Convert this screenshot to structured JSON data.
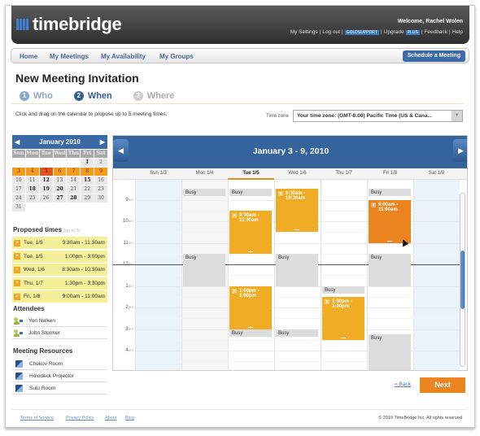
{
  "header": {
    "logo": "timebridge",
    "welcome": "Welcome, Rachel Wolen",
    "links": [
      "My Settings",
      "Log out",
      "GOLDSUPPORT",
      "Upgrade",
      "PLUS",
      "Feedback",
      "Help"
    ]
  },
  "nav": {
    "items": [
      "Home",
      "My Meetings",
      "My Availability",
      "My Groups"
    ],
    "schedule_button": "Schedule a Meeting"
  },
  "page": {
    "title": "New Meeting Invitation",
    "steps": [
      {
        "num": "1",
        "label": "Who",
        "state": "done"
      },
      {
        "num": "2",
        "label": "When",
        "state": "current"
      },
      {
        "num": "3",
        "label": "Where",
        "state": "upcoming"
      }
    ],
    "instruction": "Click and drag on the calendar to propose up to 5 meeting times.",
    "timezone_label": "Time zone",
    "timezone_value": "Your time zone: (GMT-8:00) Pacific Time (US & Cana..."
  },
  "mini_calendar": {
    "title": "January 2010",
    "prev": "◀",
    "next": "▶",
    "dow": [
      "Sun",
      "Mon",
      "Tue",
      "Wed",
      "Thu",
      "Fri",
      "Sat"
    ],
    "weeks": [
      [
        "",
        "",
        "",
        "",
        "",
        "1",
        "2"
      ],
      [
        "3",
        "4",
        "5",
        "6",
        "7",
        "8",
        "9"
      ],
      [
        "10",
        "11",
        "12",
        "13",
        "14",
        "15",
        "16"
      ],
      [
        "17",
        "18",
        "19",
        "20",
        "21",
        "22",
        "23"
      ],
      [
        "24",
        "25",
        "26",
        "27",
        "28",
        "29",
        "30"
      ],
      [
        "31",
        "",
        "",
        "",
        "",
        "",
        ""
      ]
    ],
    "bold_days": [
      "1",
      "12",
      "15",
      "18",
      "19",
      "20",
      "27",
      "28"
    ],
    "selected_week": [
      "3",
      "4",
      "5",
      "6",
      "7",
      "8",
      "9"
    ],
    "today": "5"
  },
  "proposed": {
    "title": "Proposed times",
    "hint": "(up to 5)",
    "items": [
      {
        "day": "Tue, 1/5",
        "time": "9:30am - 11:30am"
      },
      {
        "day": "Tue, 1/5",
        "time": "1:00pm - 3:00pm"
      },
      {
        "day": "Wed, 1/6",
        "time": "8:30am - 10:30am"
      },
      {
        "day": "Thu, 1/7",
        "time": "1:30pm - 3:30pm"
      },
      {
        "day": "Fri, 1/8",
        "time": "9:00am - 11:00am"
      }
    ]
  },
  "attendees": {
    "title": "Attendees",
    "items": [
      "Yori Nelken",
      "John Stormer"
    ]
  },
  "resources": {
    "title": "Meeting Resources",
    "items": [
      "Chekov Room",
      "Holodeck Projector",
      "Sulu Room"
    ]
  },
  "calendar": {
    "title": "January 3 - 9, 2010",
    "prev": "◀",
    "next": "▶",
    "days": [
      "Sun 1/3",
      "Mon 1/4",
      "Tue 1/5",
      "Wed 1/6",
      "Thu 1/7",
      "Fri 1/8",
      "Sat 1/9"
    ],
    "today_index": 2,
    "hours": [
      {
        "h": "9",
        "ap": "am"
      },
      {
        "h": "10",
        "ap": "am"
      },
      {
        "h": "11",
        "ap": "am"
      },
      {
        "h": "12",
        "ap": "pm"
      },
      {
        "h": "1",
        "ap": "pm"
      },
      {
        "h": "2",
        "ap": "pm"
      },
      {
        "h": "3",
        "ap": "pm"
      },
      {
        "h": "4",
        "ap": "pm"
      },
      {
        "h": "5",
        "ap": "pm"
      }
    ],
    "busy_label": "Busy",
    "events": [
      {
        "type": "busy",
        "day": 1,
        "start": 8.5,
        "end": 8.8
      },
      {
        "type": "busy",
        "day": 2,
        "start": 8.5,
        "end": 8.8
      },
      {
        "type": "busy",
        "day": 5,
        "start": 8.5,
        "end": 8.8
      },
      {
        "type": "busy",
        "day": 1,
        "start": 11.5,
        "end": 13.0
      },
      {
        "type": "busy",
        "day": 3,
        "start": 11.5,
        "end": 13.0
      },
      {
        "type": "busy",
        "day": 5,
        "start": 11.5,
        "end": 13.0
      },
      {
        "type": "busy",
        "day": 4,
        "start": 13.0,
        "end": 13.3
      },
      {
        "type": "busy",
        "day": 2,
        "start": 15.0,
        "end": 15.3
      },
      {
        "type": "busy",
        "day": 3,
        "start": 15.0,
        "end": 15.3
      },
      {
        "type": "busy",
        "day": 5,
        "start": 15.25,
        "end": 17.0
      },
      {
        "type": "proposed",
        "day": 2,
        "start": 9.5,
        "end": 11.5,
        "label": "9:30am - 11:30am"
      },
      {
        "type": "proposed",
        "day": 3,
        "start": 8.5,
        "end": 10.5,
        "label": "8:30am - 10:30am"
      },
      {
        "type": "proposed",
        "day": 5,
        "start": 9.0,
        "end": 11.0,
        "label": "9:00am - 11:00am",
        "active": true
      },
      {
        "type": "proposed",
        "day": 2,
        "start": 13.0,
        "end": 15.0,
        "label": "1:00pm - 3:00pm"
      },
      {
        "type": "proposed",
        "day": 4,
        "start": 13.5,
        "end": 15.5,
        "label": "1:30pm - 3:30pm"
      }
    ],
    "now_hour": 12.0
  },
  "actions": {
    "back": "« Back",
    "next": "Next"
  },
  "footer": {
    "links": [
      "Terms of Service",
      "Privacy Policy",
      "About",
      "Blog"
    ],
    "copyright": "© 2010 TimeBridge Inc. All rights reserved"
  }
}
